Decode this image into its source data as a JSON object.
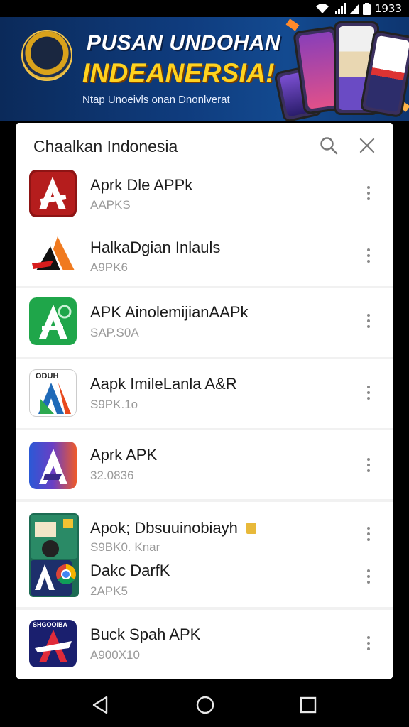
{
  "status_bar": {
    "time": "1933",
    "icons": [
      "wifi-icon",
      "signal-icon",
      "signal-secondary-icon",
      "battery-icon"
    ]
  },
  "banner": {
    "title_line1": "PUSAN UNDOHAN",
    "title_line2": "INDEANERSIA!",
    "subtitle": "Ntap Unoeivls onan Dnonlverat",
    "accent_color": "#ffd21f",
    "background_color": "#0f3c7e"
  },
  "dialog": {
    "title": "Chaalkan Indonesia",
    "search_icon": "search-icon",
    "close_icon": "close-icon"
  },
  "apps": [
    {
      "name": "Aprk Dle APPk",
      "sub": "AAPKS",
      "icon": "red-a-app-icon"
    },
    {
      "name": "HalkaDgian Inlauls",
      "sub": "A9PK6",
      "icon": "orange-black-a-app-icon"
    },
    {
      "name": "APK AinolemijianAAPk",
      "sub": "SAP.S0A",
      "icon": "green-a-app-icon"
    },
    {
      "name": "Aapk ImileLanla A&R",
      "sub": "S9PK.1o",
      "icon": "white-a-app-icon",
      "icon_text": "ODUH"
    },
    {
      "name": "Aprk APK",
      "sub": "32.0836",
      "icon": "blue-orange-a-app-icon"
    },
    {
      "name": "Apok; Dbsuuinobiayh",
      "sub": "S9BK0. Knar",
      "icon": "collage-app-icon"
    },
    {
      "name": "Dakc DarfK",
      "sub": "2APK5",
      "icon": "chrome-a-app-icon"
    },
    {
      "name": "Buck Spah APK",
      "sub": "A900X10",
      "icon": "navy-a-app-icon",
      "icon_text": "SHGOOIBA"
    }
  ],
  "nav_bar": {
    "back": "back-triangle-icon",
    "home": "home-circle-icon",
    "recents": "recents-square-icon"
  }
}
